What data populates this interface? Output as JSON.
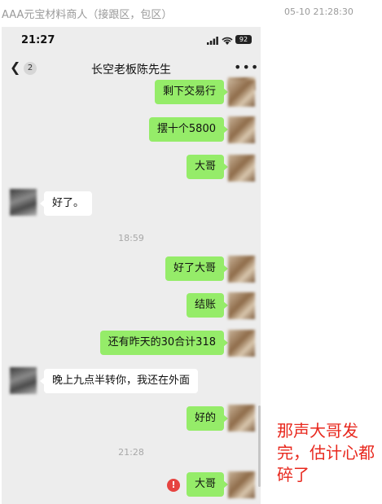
{
  "header": {
    "sender": "AAA元宝材料商人（接跟区，包区）",
    "timestamp": "05-10 21:28:30"
  },
  "status_bar": {
    "time": "21:27",
    "battery": "92"
  },
  "chat": {
    "back_icon": "chevron-left-icon",
    "unread_count": "2",
    "title": "长空老板陈先生",
    "more_icon": "more-icon"
  },
  "messages": [
    {
      "dir": "out",
      "text": "剩下交易行"
    },
    {
      "dir": "out",
      "text": "摆十个5800"
    },
    {
      "dir": "out",
      "text": "大哥"
    },
    {
      "dir": "in",
      "text": "好了。"
    },
    {
      "dir": "out",
      "text": "好了大哥"
    },
    {
      "dir": "out",
      "text": "结账"
    },
    {
      "dir": "out",
      "text": "还有昨天的30合计318"
    },
    {
      "dir": "in",
      "text": "晚上九点半转你，我还在外面"
    },
    {
      "dir": "out",
      "text": "好的"
    },
    {
      "dir": "out",
      "text": "大哥",
      "failed": true
    }
  ],
  "timestamps": [
    "18:59",
    "21:28"
  ],
  "failed_icon": "!",
  "annotation": "那声大哥发完，估计心都碎了",
  "colors": {
    "outgoing_bubble": "#95ec69",
    "incoming_bubble": "#ffffff",
    "chat_background": "#ededed",
    "annotation": "#e8281e",
    "failed": "#e64340"
  }
}
